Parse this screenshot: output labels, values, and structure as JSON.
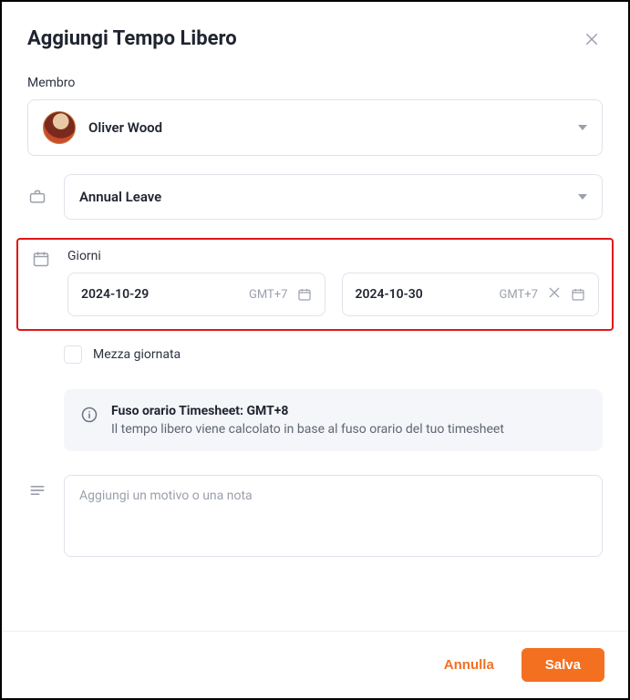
{
  "header": {
    "title": "Aggiungi Tempo Libero"
  },
  "member": {
    "label": "Membro",
    "selected": "Oliver Wood"
  },
  "leaveType": {
    "selected": "Annual Leave"
  },
  "days": {
    "label": "Giorni",
    "start": {
      "value": "2024-10-29",
      "tz": "GMT+7"
    },
    "end": {
      "value": "2024-10-30",
      "tz": "GMT+7"
    }
  },
  "halfDay": {
    "checked": false,
    "label": "Mezza giornata"
  },
  "tzInfo": {
    "title": "Fuso orario Timesheet: GMT+8",
    "subtitle": "Il tempo libero viene calcolato in base al fuso orario del tuo timesheet"
  },
  "note": {
    "placeholder": "Aggiungi un motivo o una nota",
    "value": ""
  },
  "footer": {
    "cancel": "Annulla",
    "save": "Salva"
  }
}
